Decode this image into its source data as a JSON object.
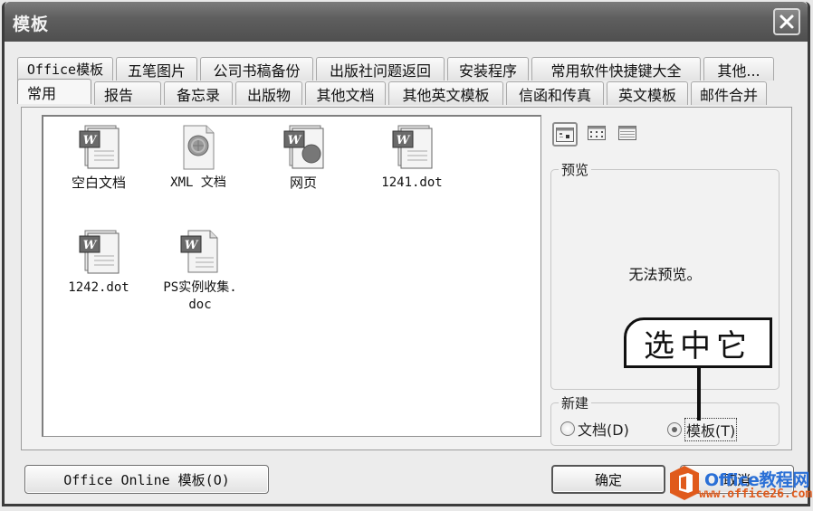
{
  "window": {
    "title": "模板",
    "close_icon": "close-icon"
  },
  "tabs": {
    "row_back": [
      {
        "label": "Office模板"
      },
      {
        "label": "五笔图片"
      },
      {
        "label": "公司书稿备份"
      },
      {
        "label": "出版社问题返回"
      },
      {
        "label": "安装程序"
      },
      {
        "label": "常用软件快捷键大全"
      },
      {
        "label": "其他..."
      }
    ],
    "row_front": [
      {
        "label": "常用",
        "active": true
      },
      {
        "label": "报告"
      },
      {
        "label": "备忘录"
      },
      {
        "label": "出版物"
      },
      {
        "label": "其他文档"
      },
      {
        "label": "其他英文模板"
      },
      {
        "label": "信函和传真"
      },
      {
        "label": "英文模板"
      },
      {
        "label": "邮件合并"
      }
    ]
  },
  "templates": [
    {
      "label": "空白文档",
      "icon": "word-document-icon",
      "selected": true
    },
    {
      "label": "XML 文档",
      "icon": "xml-document-icon"
    },
    {
      "label": "网页",
      "icon": "web-page-icon"
    },
    {
      "label": "1241.dot",
      "icon": "word-template-icon"
    },
    {
      "label": "1242.dot",
      "icon": "word-template-icon"
    },
    {
      "label": "PS实例收集.doc",
      "label_line1": "PS实例收集.",
      "label_line2": "doc",
      "icon": "word-doc-file-icon"
    }
  ],
  "view_buttons": [
    {
      "name": "large-icons-view",
      "active": true
    },
    {
      "name": "list-view"
    },
    {
      "name": "details-view"
    }
  ],
  "preview": {
    "legend": "预览",
    "message": "无法预览。"
  },
  "new_group": {
    "legend": "新建",
    "options": [
      {
        "label": "文档",
        "hotkey": "D",
        "display": "文档(D)",
        "checked": false
      },
      {
        "label": "模板",
        "hotkey": "T",
        "display": "模板(T)",
        "checked": true
      }
    ]
  },
  "callout": {
    "text": "选中它"
  },
  "buttons": {
    "office_online": "Office Online 模板(O)",
    "ok": "确定",
    "cancel": "取消"
  },
  "watermark": {
    "line1": "Office教程网",
    "line2": "www.office26.com",
    "colors": {
      "brand_blue": "#2a6fd6",
      "brand_orange": "#e05a1b"
    }
  }
}
